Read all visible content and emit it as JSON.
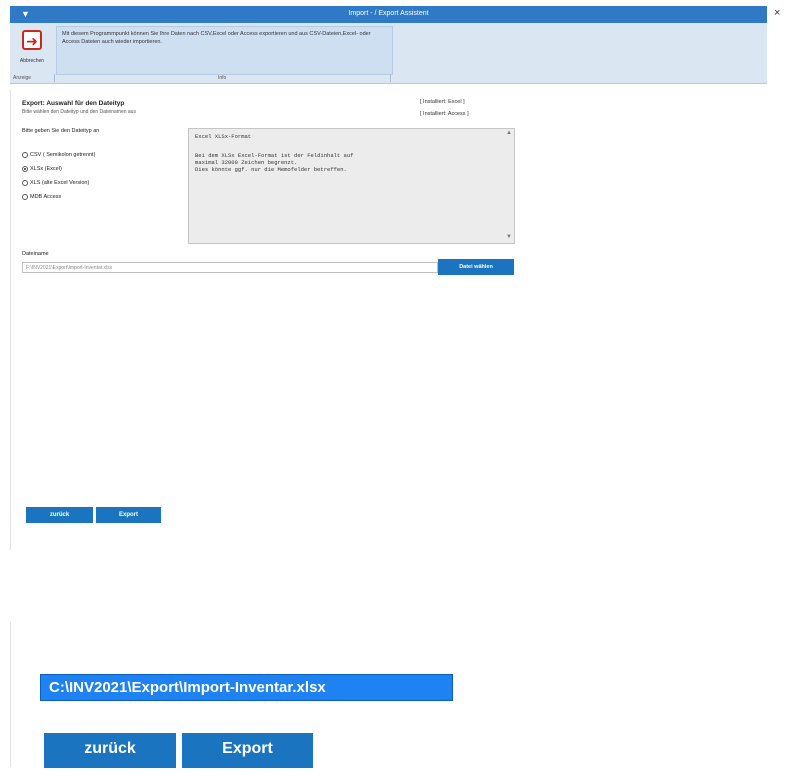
{
  "window": {
    "title": "Import - / Export Assistent",
    "close": "×",
    "menu_icon": "▼"
  },
  "ribbon": {
    "cancel_label": "Abbrechen",
    "cancel_icon": "exit-arrow-icon",
    "info_text": "Mit diesem Programmpunkt können Sie Ihre Daten nach CSV,Excel oder Access exportieren und aus CSV-Dateien,Excel- oder Access Dateien auch wieder importieren.",
    "group_anzeige": "Anzeige",
    "group_info": "Info"
  },
  "header": {
    "title": "Export: Auswahl für den Dateityp",
    "subtitle": "Bitte wählen den Dateityp und den Dateinamen aus",
    "installed_excel": "[ Installiert: Excel ]",
    "installed_access": "[ Installiert: Access ]"
  },
  "filetype": {
    "prompt": "Bitte geben Sie den Dateityp an",
    "options": [
      {
        "label": "CSV ( Semikolon getrennt)",
        "selected": false
      },
      {
        "label": "XLSx (Excel)",
        "selected": true
      },
      {
        "label": "XLS (alte Excel Version)",
        "selected": false
      },
      {
        "label": "MDB Access",
        "selected": false
      }
    ]
  },
  "infobox": {
    "line1": "Excel XLSx-Format",
    "line2": "Bei dem XLSx Excel-Format ist der Feldinhalt auf",
    "line3": "maximal 32000 Zeichen begrenzt.",
    "line4": "Dies könnte ggf. nur die Memofelder betreffen."
  },
  "filename": {
    "label": "Dateiname",
    "value": "F:\\INV2021\\Export\\Import-Inventar.xlsx",
    "choose_button": "Datei wählen"
  },
  "buttons": {
    "back": "zurück",
    "export": "Export"
  },
  "zoom": {
    "path": "C:\\INV2021\\Export\\Import-Inventar.xlsx",
    "back": "zurück",
    "export": "Export"
  },
  "colors": {
    "accent": "#1a74c0",
    "titlebar": "#2f79c7",
    "highlight": "#1e82f2"
  }
}
